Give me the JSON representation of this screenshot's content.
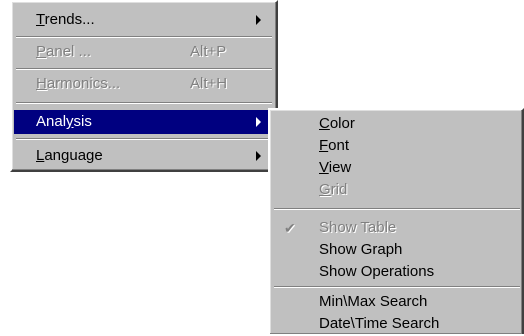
{
  "main_menu": {
    "items": [
      {
        "pre": "",
        "mn": "T",
        "post": "rends...",
        "accel": "",
        "submenu": true,
        "disabled": false,
        "selected": false
      },
      {
        "pre": "",
        "mn": "P",
        "post": "anel ...",
        "accel": "Alt+P",
        "submenu": false,
        "disabled": true,
        "selected": false
      },
      {
        "pre": "",
        "mn": "H",
        "post": "armonics...",
        "accel": "Alt+H",
        "submenu": false,
        "disabled": true,
        "selected": false
      },
      {
        "pre": "Anal",
        "mn": "y",
        "post": "sis",
        "accel": "",
        "submenu": true,
        "disabled": false,
        "selected": true
      },
      {
        "pre": "",
        "mn": "L",
        "post": "anguage",
        "accel": "",
        "submenu": true,
        "disabled": false,
        "selected": false
      }
    ]
  },
  "sub_menu": {
    "items": [
      {
        "pre": "",
        "mn": "C",
        "post": "olor",
        "disabled": false,
        "checked": false
      },
      {
        "pre": "",
        "mn": "F",
        "post": "ont",
        "disabled": false,
        "checked": false
      },
      {
        "pre": "",
        "mn": "V",
        "post": "iew",
        "disabled": false,
        "checked": false
      },
      {
        "pre": "",
        "mn": "G",
        "post": "rid",
        "disabled": true,
        "checked": false
      },
      {
        "pre": "Show Table",
        "mn": "",
        "post": "",
        "disabled": true,
        "checked": true
      },
      {
        "pre": "Show Graph",
        "mn": "",
        "post": "",
        "disabled": false,
        "checked": false
      },
      {
        "pre": "Show Operations",
        "mn": "",
        "post": "",
        "disabled": false,
        "checked": false
      },
      {
        "pre": "Min\\Max Search",
        "mn": "",
        "post": "",
        "disabled": false,
        "checked": false
      },
      {
        "pre": "Date\\Time Search",
        "mn": "",
        "post": "",
        "disabled": false,
        "checked": false
      }
    ]
  },
  "glyphs": {
    "check": "✔"
  },
  "colors": {
    "menu_bg": "#c0c0c0",
    "highlight": "#000080",
    "disabled_text": "#808080"
  }
}
